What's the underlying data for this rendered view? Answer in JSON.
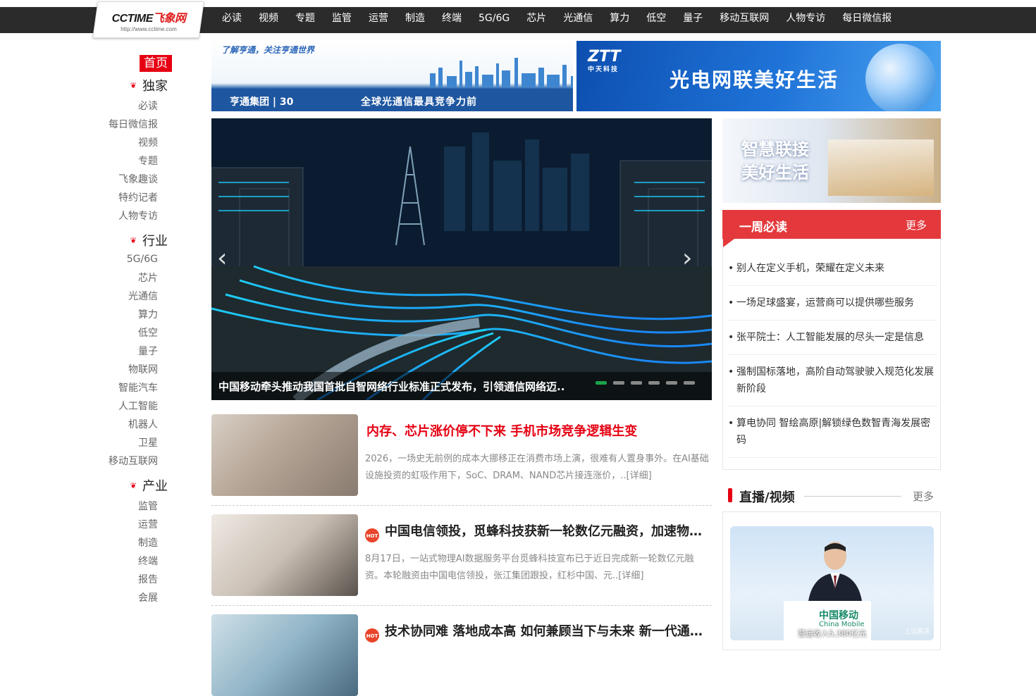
{
  "logo": {
    "main": "CCTIME",
    "cn": "飞象网",
    "url": "http://www.cctime.com"
  },
  "nav": [
    "必读",
    "视频",
    "专题",
    "监管",
    "运营",
    "制造",
    "终端",
    "5G/6G",
    "芯片",
    "光通信",
    "算力",
    "低空",
    "量子",
    "移动互联网",
    "人物专访",
    "每日微信报"
  ],
  "leftnav": {
    "home": "首页",
    "sections": [
      {
        "title": "独家",
        "items": [
          "必读",
          "每日微信报",
          "视频",
          "专题",
          "飞象趣谈",
          "特约记者",
          "人物专访"
        ]
      },
      {
        "title": "行业",
        "items": [
          "5G/6G",
          "芯片",
          "光通信",
          "算力",
          "低空",
          "量子",
          "物联网",
          "智能汽车",
          "人工智能",
          "机器人",
          "卫星",
          "移动互联网"
        ]
      },
      {
        "title": "产业",
        "items": [
          "监管",
          "运营",
          "制造",
          "终端",
          "报告",
          "会展"
        ]
      }
    ]
  },
  "ads": {
    "hengtong_slogan": "了解亨通，关注亨通世界",
    "hengtong_brand": "亨通集团 | 30",
    "hengtong_tag": "全球光通信最具竞争力前",
    "ztt_logo": "ZTT",
    "ztt_cn": "中天科技",
    "ztt_msg": "光电网联美好生活",
    "side_line1": "智慧联接",
    "side_line2": "美好生活"
  },
  "slider": {
    "caption": "中国移动牵头推动我国首批自智网络行业标准正式发布，引领通信网络迈..",
    "dots": 6,
    "active": 0
  },
  "news": [
    {
      "title": "内存、芯片涨价停不下来 手机市场竞争逻辑生变",
      "desc": "2026，一场史无前例的成本大挪移正在消费市场上演，很难有人置身事外。在AI基础设施投资的虹吸作用下，SoC、DRAM、NAND芯片接连涨价，..[详细]",
      "hot": false,
      "red": true
    },
    {
      "title": "中国电信领投，觅蜂科技获新一轮数亿元融资，加速物理AI数据服务",
      "desc": "8月17日，一站式物理AI数据服务平台觅蜂科技宣布已于近日完成新一轮数亿元融资。本轮融资由中国电信领投，张江集团跟投，红杉中国、元..[详细]",
      "hot": true,
      "red": false
    },
    {
      "title": "技术协同难 落地成本高 如何兼顾当下与未来 新一代通信网络",
      "desc": "",
      "hot": true,
      "red": false
    }
  ],
  "hot_label": "HOT",
  "weekly": {
    "title": "一周必读",
    "more": "更多",
    "items": [
      "别人在定义手机，荣耀在定义未来",
      "一场足球盛宴，运营商可以提供哪些服务",
      "张平院士：人工智能发展的尽头一定是信息",
      "强制国标落地，高阶自动驾驶驶入规范化发展新阶段",
      "算电协同 智绘高原|解锁绿色数智青海发展密码"
    ]
  },
  "live": {
    "title": "直播/视频",
    "more": "更多",
    "logo_cn": "中国移动",
    "logo_en": "China Mobile",
    "caption": "营运收入5,380亿元",
    "watermark": "上证路演"
  }
}
